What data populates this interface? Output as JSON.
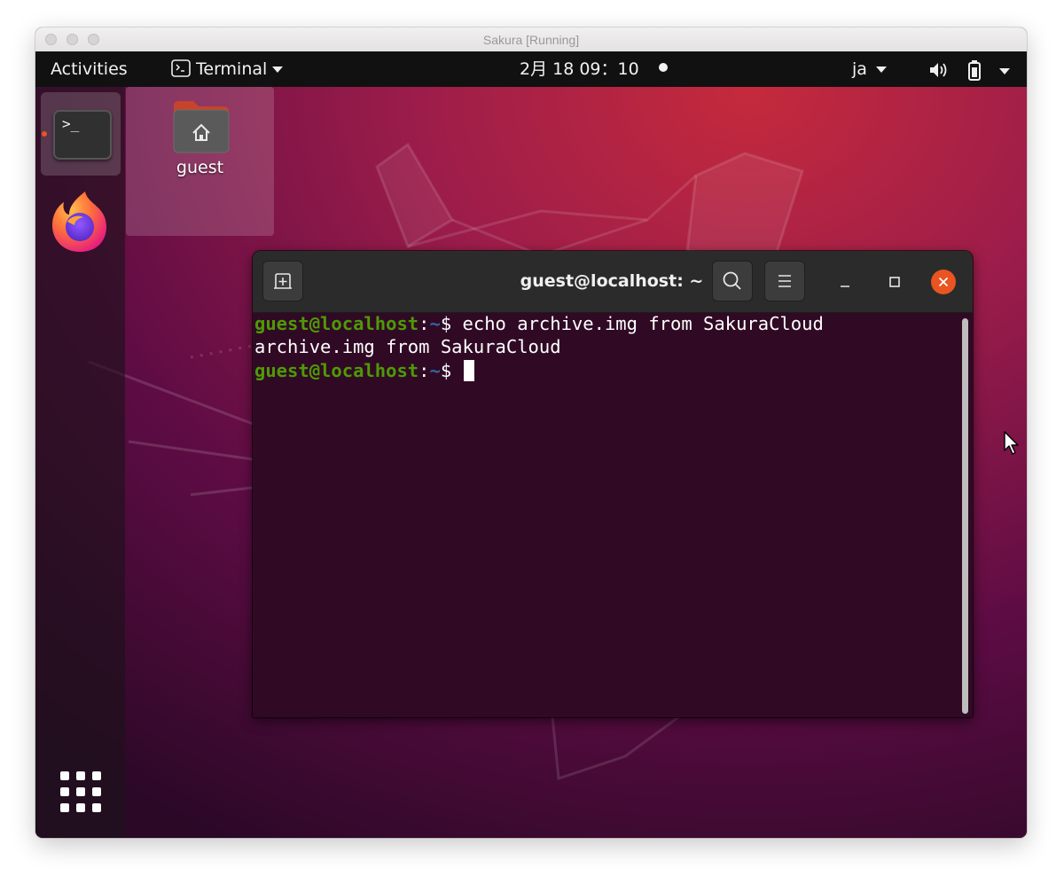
{
  "host_window": {
    "title": "Sakura [Running]"
  },
  "topbar": {
    "activities_label": "Activities",
    "app_menu_label": "Terminal",
    "clock": "2月 18 09：10",
    "language": "ja"
  },
  "dock": {
    "items": [
      {
        "name": "Terminal",
        "icon": "terminal-icon",
        "active": true
      },
      {
        "name": "Firefox",
        "icon": "firefox-icon",
        "active": false
      }
    ],
    "terminal_glyph": ">_",
    "show_apps_icon": "apps-grid-icon"
  },
  "desktop": {
    "icons": [
      {
        "label": "guest",
        "icon": "home-folder-icon"
      }
    ]
  },
  "terminal": {
    "title": "guest@localhost: ~",
    "lines": [
      {
        "user_host": "guest@localhost",
        "colon": ":",
        "path": "~",
        "symbol": "$ ",
        "command": "echo archive.img from SakuraCloud"
      },
      {
        "output": "archive.img from SakuraCloud"
      },
      {
        "user_host": "guest@localhost",
        "colon": ":",
        "path": "~",
        "symbol": "$ ",
        "command": ""
      }
    ]
  },
  "colors": {
    "accent": "#e95420",
    "terminal_bg": "#300a24",
    "prompt_user": "#4e9a06",
    "prompt_path": "#3465a4",
    "topbar_bg": "#111111"
  }
}
